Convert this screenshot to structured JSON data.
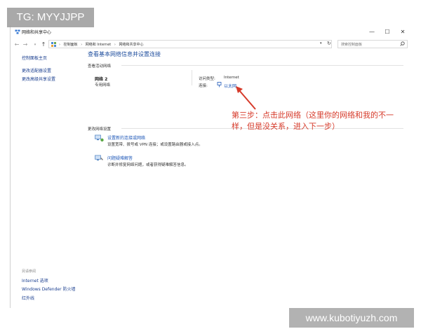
{
  "window": {
    "title": "网络和共享中心",
    "controls": {
      "minimize": "—",
      "maximize": "☐",
      "close": "✕"
    }
  },
  "address": {
    "breadcrumbs": [
      "控制面板",
      "网络和 Internet",
      "网络和共享中心"
    ],
    "separator": "›",
    "search_placeholder": "搜索控制面板"
  },
  "sidebar": {
    "links": [
      "控制面板主页",
      "更改适配器设置",
      "更改高级共享设置"
    ],
    "see_also_heading": "另请参阅",
    "see_also_links": [
      "Internet 选项",
      "Windows Defender 防火墙",
      "红外线"
    ]
  },
  "main": {
    "title": "查看基本网络信息并设置连接",
    "active_networks_heading": "查看活动网络",
    "network": {
      "name": "网络 2",
      "category": "专用网络",
      "access_type_label": "访问类型:",
      "access_type_value": "Internet",
      "connections_label": "连接:",
      "connection_value": "以太网"
    },
    "change_settings_heading": "更改网络设置",
    "tasks": [
      {
        "title": "设置新的连接或网络",
        "desc": "设置宽带、拨号或 VPN 连接；或设置路由器或接入点。"
      },
      {
        "title": "问题疑难解答",
        "desc": "诊断并修复网络问题，或者获得疑难解答信息。"
      }
    ]
  },
  "annotation": {
    "text": "第三步：点击此网络（这里你的网络和我的不一样，但是没关系，进入下一步）",
    "color": "#d63a2a"
  },
  "watermarks": {
    "top_left": "TG: MYYJJPP",
    "bottom_right": "www.kubotiyuzh.com"
  }
}
